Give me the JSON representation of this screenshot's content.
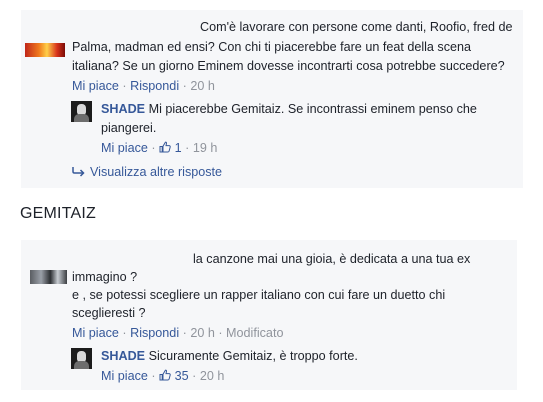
{
  "section_heading": "GEMITAIZ",
  "thread1": {
    "comment_lines": [
      "Com'è lavorare con persone come danti, Roofio, fred de",
      "Palma, madman ed ensi? Con chi ti piacerebbe fare un feat della scena",
      "italiana? Se un giorno Eminem dovesse incontrarti cosa potrebbe succedere?"
    ],
    "actions": {
      "like": "Mi piace",
      "reply": "Rispondi",
      "time": "20 h"
    },
    "reply": {
      "author": "SHADE",
      "text_line1": "Mi piacerebbe Gemitaiz. Se incontrassi eminem penso che",
      "text_line2": "piangerei.",
      "like": "Mi piace",
      "like_count": "1",
      "time": "19 h"
    },
    "more_replies": "Visualizza altre risposte"
  },
  "thread2": {
    "comment_lines": [
      "la canzone mai una gioia, è dedicata a una tua ex",
      "immagino ?",
      "e , se potessi scegliere un rapper italiano con cui fare un duetto chi",
      "sceglieresti ?"
    ],
    "actions": {
      "like": "Mi piace",
      "reply": "Rispondi",
      "time": "20 h",
      "edited": "Modificato"
    },
    "reply": {
      "author": "SHADE",
      "text": "Sicuramente Gemitaiz, è troppo forte.",
      "like": "Mi piace",
      "like_count": "35",
      "time": "20 h"
    }
  },
  "icons": {
    "like": "thumbs-up-icon",
    "reply": "reply-arrow-icon"
  },
  "colors": {
    "link": "#365899",
    "meta": "#90949c",
    "text": "#1d2129",
    "panel": "#f6f7f9"
  }
}
